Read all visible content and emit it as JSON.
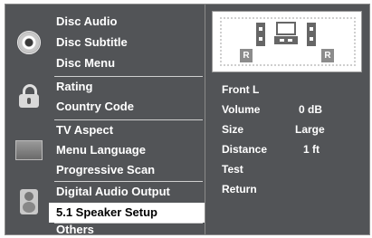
{
  "menu": {
    "groups": [
      {
        "icon": "disc-icon",
        "items": [
          "Disc Audio",
          "Disc Subtitle",
          "Disc Menu"
        ]
      },
      {
        "icon": "lock-icon",
        "items": [
          "Rating",
          "Country Code"
        ]
      },
      {
        "icon": "tv-icon",
        "items": [
          "TV Aspect",
          "Menu Language",
          "Progressive Scan"
        ]
      },
      {
        "icon": "speaker-icon",
        "items": [
          "Digital Audio Output",
          "5.1 Speaker Setup"
        ]
      },
      {
        "icon": null,
        "items": [
          "Others"
        ]
      }
    ],
    "selected": "5.1 Speaker Setup"
  },
  "speaker_setup": {
    "speaker_labels": [
      "R",
      "R"
    ],
    "options": [
      {
        "label": "Front L",
        "value": ""
      },
      {
        "label": "Volume",
        "value": "0 dB"
      },
      {
        "label": "Size",
        "value": "Large"
      },
      {
        "label": "Distance",
        "value": "1 ft"
      },
      {
        "label": "Test",
        "value": ""
      },
      {
        "label": "Return",
        "value": ""
      }
    ]
  },
  "colors": {
    "panel_bg": "#525457",
    "selected_bg": "#ffffff",
    "text": "#ffffff"
  }
}
